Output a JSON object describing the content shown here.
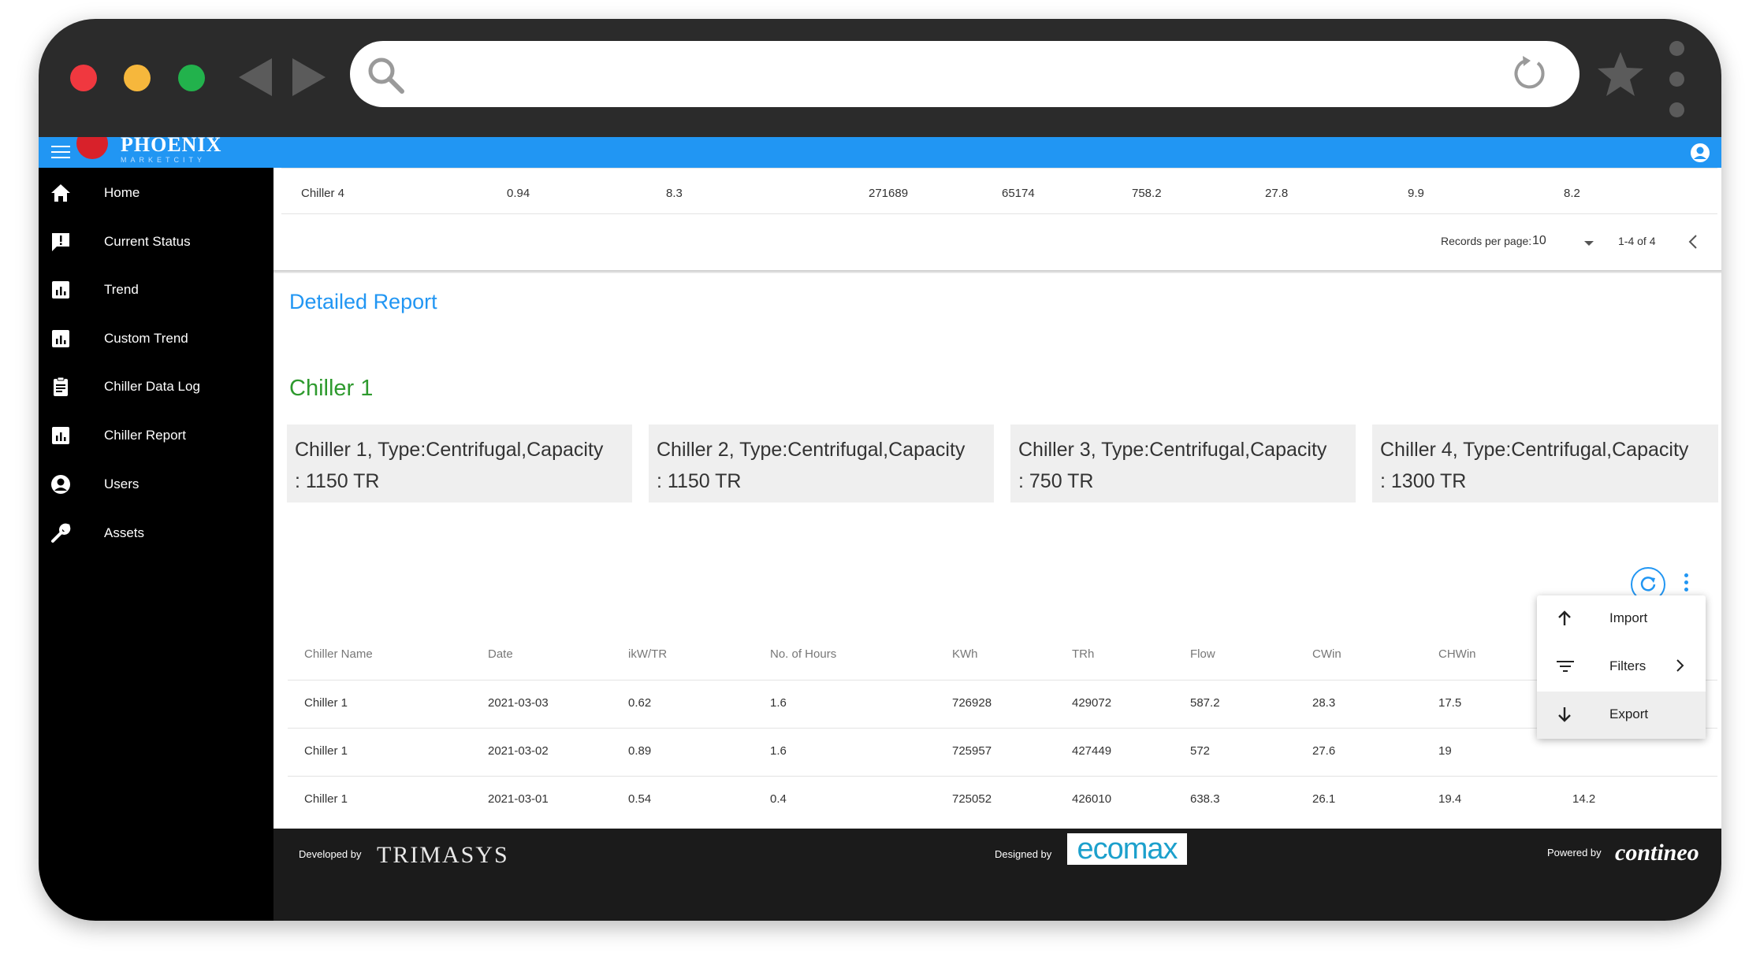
{
  "app": {
    "logo_text": "PHOENIX",
    "logo_sub": "MARKETCITY"
  },
  "sidebar": {
    "items": [
      {
        "label": "Home"
      },
      {
        "label": "Current Status"
      },
      {
        "label": "Trend"
      },
      {
        "label": "Custom Trend"
      },
      {
        "label": "Chiller Data Log"
      },
      {
        "label": "Chiller Report"
      },
      {
        "label": "Users"
      },
      {
        "label": "Assets"
      }
    ]
  },
  "summary_table": {
    "last_row": [
      "Chiller 4",
      "0.94",
      "8.3",
      "271689",
      "65174",
      "758.2",
      "27.8",
      "9.9",
      "8.2"
    ],
    "pagination": {
      "records_label": "Records per page:",
      "per_page": "10",
      "range": "1-4 of 4"
    }
  },
  "report": {
    "section_title": "Detailed Report",
    "chiller_title": "Chiller 1",
    "cards": [
      {
        "line1": "Chiller 1, Type:Centrifugal,Capacity",
        "line2": ": 1150 TR"
      },
      {
        "line1": "Chiller 2, Type:Centrifugal,Capacity",
        "line2": ": 1150 TR"
      },
      {
        "line1": "Chiller 3, Type:Centrifugal,Capacity",
        "line2": ": 750 TR"
      },
      {
        "line1": "Chiller 4, Type:Centrifugal,Capacity",
        "line2": ": 1300 TR"
      }
    ],
    "table": {
      "headers": [
        "Chiller Name",
        "Date",
        "ikW/TR",
        "No. of Hours",
        "KWh",
        "TRh",
        "Flow",
        "CWin",
        "CHWin"
      ],
      "rows": [
        [
          "Chiller 1",
          "2021-03-03",
          "0.62",
          "1.6",
          "726928",
          "429072",
          "587.2",
          "28.3",
          "17.5",
          ""
        ],
        [
          "Chiller 1",
          "2021-03-02",
          "0.89",
          "1.6",
          "725957",
          "427449",
          "572",
          "27.6",
          "19",
          ""
        ],
        [
          "Chiller 1",
          "2021-03-01",
          "0.54",
          "0.4",
          "725052",
          "426010",
          "638.3",
          "26.1",
          "19.4",
          "14.2"
        ]
      ]
    },
    "menu": {
      "import": "Import",
      "filters": "Filters",
      "export": "Export"
    }
  },
  "footer": {
    "developed_by": "Developed by",
    "developer": "TRIMASYS",
    "designed_by": "Designed by",
    "designer": "ecomax",
    "powered_by": "Powered by",
    "powerer": "contineo"
  },
  "colors": {
    "primary": "#2196f3",
    "chiller_title": "#2e9a2e",
    "sidebar": "#000000",
    "footer": "#1b1b1b"
  }
}
